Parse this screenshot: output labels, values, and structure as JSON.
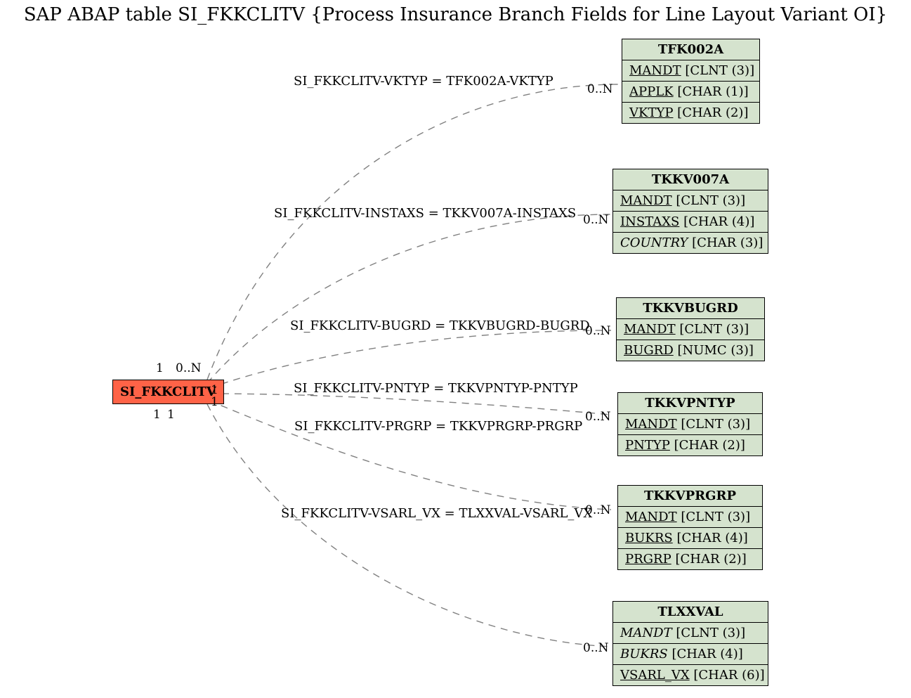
{
  "chart_data": {
    "type": "diagram",
    "title": "SAP ABAP table SI_FKKCLITV {Process Insurance Branch Fields for Line Layout Variant OI}",
    "main_entity": "SI_FKKCLITV",
    "relations": [
      {
        "label": "SI_FKKCLITV-VKTYP = TFK002A-VKTYP",
        "target": "TFK002A",
        "left_card": "1",
        "right_card": "0..N"
      },
      {
        "label": "SI_FKKCLITV-INSTAXS = TKKV007A-INSTAXS",
        "target": "TKKV007A",
        "left_card": "0..N",
        "right_card": "0..N"
      },
      {
        "label": "SI_FKKCLITV-BUGRD = TKKVBUGRD-BUGRD",
        "target": "TKKVBUGRD",
        "left_card": "1",
        "right_card": "0..N"
      },
      {
        "label": "SI_FKKCLITV-PNTYP = TKKVPNTYP-PNTYP",
        "target": "TKKVPNTYP",
        "left_card": "1",
        "right_card": "0..N"
      },
      {
        "label": "SI_FKKCLITV-PRGRP = TKKVPRGRP-PRGRP",
        "target": "TKKVPRGRP",
        "left_card": "1",
        "right_card": "0..N"
      },
      {
        "label": "SI_FKKCLITV-VSARL_VX = TLXXVAL-VSARL_VX",
        "target": "TLXXVAL",
        "left_card": "1",
        "right_card": "0..N"
      }
    ],
    "entities": {
      "TFK002A": {
        "header": "TFK002A",
        "rows": [
          [
            "MANDT",
            "CLNT (3)",
            true,
            false
          ],
          [
            "APPLK",
            "CHAR (1)",
            true,
            false
          ],
          [
            "VKTYP",
            "CHAR (2)",
            true,
            false
          ]
        ]
      },
      "TKKV007A": {
        "header": "TKKV007A",
        "rows": [
          [
            "MANDT",
            "CLNT (3)",
            true,
            false
          ],
          [
            "INSTAXS",
            "CHAR (4)",
            true,
            false
          ],
          [
            "COUNTRY",
            "CHAR (3)",
            false,
            true
          ]
        ]
      },
      "TKKVBUGRD": {
        "header": "TKKVBUGRD",
        "rows": [
          [
            "MANDT",
            "CLNT (3)",
            true,
            false
          ],
          [
            "BUGRD",
            "NUMC (3)",
            true,
            false
          ]
        ]
      },
      "TKKVPNTYP": {
        "header": "TKKVPNTYP",
        "rows": [
          [
            "MANDT",
            "CLNT (3)",
            true,
            false
          ],
          [
            "PNTYP",
            "CHAR (2)",
            true,
            false
          ]
        ]
      },
      "TKKVPRGRP": {
        "header": "TKKVPRGRP",
        "rows": [
          [
            "MANDT",
            "CLNT (3)",
            true,
            false
          ],
          [
            "BUKRS",
            "CHAR (4)",
            true,
            false
          ],
          [
            "PRGRP",
            "CHAR (2)",
            true,
            false
          ]
        ]
      },
      "TLXXVAL": {
        "header": "TLXXVAL",
        "rows": [
          [
            "MANDT",
            "CLNT (3)",
            false,
            true
          ],
          [
            "BUKRS",
            "CHAR (4)",
            false,
            true
          ],
          [
            "VSARL_VX",
            "CHAR (6)",
            true,
            false
          ]
        ]
      }
    },
    "left_cards_display": [
      "1",
      "0..N",
      "1",
      "1",
      "1",
      "1"
    ]
  }
}
